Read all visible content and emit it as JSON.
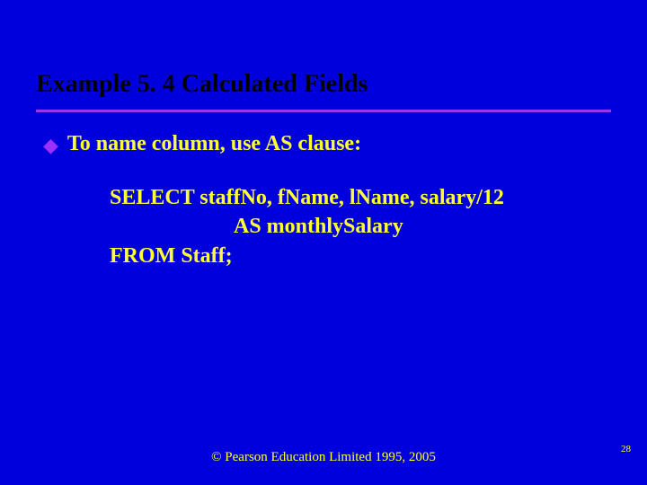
{
  "title": "Example 5. 4  Calculated Fields",
  "bullet": {
    "glyph": "◆",
    "text": "To name column, use AS clause:"
  },
  "code": {
    "line1": "SELECT staffNo, fName, lName, salary/12",
    "line2": "AS monthlySalary",
    "line3": "FROM Staff;"
  },
  "footer": "© Pearson Education Limited 1995, 2005",
  "page": "28"
}
